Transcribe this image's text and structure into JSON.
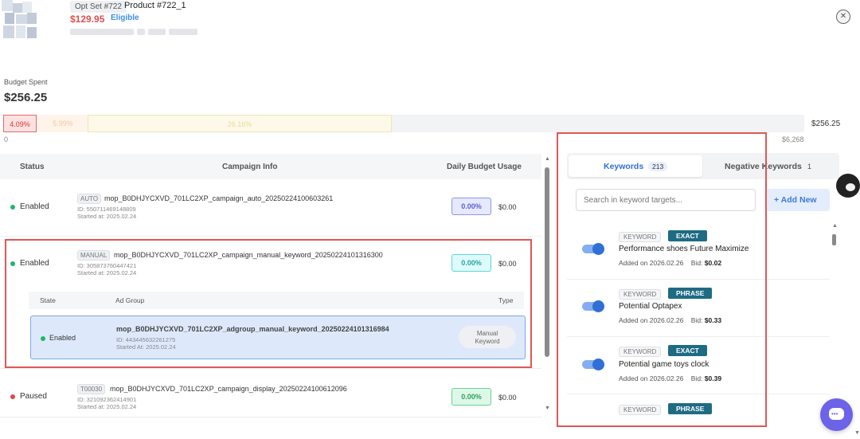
{
  "product": {
    "opt_set": "Opt Set #722",
    "title": "Product #722_1",
    "price": "$129.95",
    "eligibility": "Eligible"
  },
  "budget": {
    "label": "Budget Spent",
    "spent": "$256.25",
    "segments": [
      "4.09%",
      "5.99%",
      "26.16%"
    ],
    "bar_total": "$256.25",
    "min": "0",
    "max": "$6,268"
  },
  "table": {
    "headers": {
      "status": "Status",
      "campaign_info": "Campaign Info",
      "daily_budget": "Daily Budget Usage"
    },
    "rows": [
      {
        "status": "Enabled",
        "type": "AUTO",
        "name": "mop_B0DHJYCXVD_701LC2XP_campaign_auto_20250224100603261",
        "id": "ID: 550711469148809",
        "started": "Started at: 2025.02.24",
        "usage": "0.00%",
        "amount": "$0.00"
      },
      {
        "status": "Enabled",
        "type": "MANUAL",
        "name": "mop_B0DHJYCXVD_701LC2XP_campaign_manual_keyword_20250224101316300",
        "id": "ID: 305873760447421",
        "started": "Started at: 2025.02.24",
        "usage": "0.00%",
        "amount": "$0.00"
      },
      {
        "status": "Paused",
        "type": "T00030",
        "name": "mop_B0DHJYCXVD_701LC2XP_campaign_display_20250224100612096",
        "id": "ID: 321092362414901",
        "started": "Started at: 2025.02.24",
        "usage": "0.00%",
        "amount": "$0.00"
      }
    ],
    "adgroup": {
      "headers": {
        "state": "State",
        "ad_group": "Ad Group",
        "type": "Type"
      },
      "state": "Enabled",
      "name": "mop_B0DHJYCXVD_701LC2XP_adgroup_manual_keyword_20250224101316984",
      "id": "ID: 443445632261275",
      "started": "Started At: 2025.02.24",
      "type_line1": "Manual",
      "type_line2": "Keyword"
    }
  },
  "keywords_panel": {
    "tab_keywords": "Keywords",
    "tab_keywords_count": "213",
    "tab_negative": "Negative Keywords",
    "tab_negative_count": "1",
    "search_placeholder": "Search in keyword targets...",
    "add_new": "+ Add New",
    "items": [
      {
        "tag": "KEYWORD",
        "match": "EXACT",
        "text": "Performance shoes Future Maximize",
        "added": "Added on 2026.02.26",
        "bid_label": "Bid:",
        "bid": "$0.02"
      },
      {
        "tag": "KEYWORD",
        "match": "PHRASE",
        "text": "Potential Optapex",
        "added": "Added on 2026.02.26",
        "bid_label": "Bid:",
        "bid": "$0.33"
      },
      {
        "tag": "KEYWORD",
        "match": "EXACT",
        "text": "Potential game toys clock",
        "added": "Added on 2026.02.26",
        "bid_label": "Bid:",
        "bid": "$0.39"
      },
      {
        "tag": "KEYWORD",
        "match": "PHRASE"
      }
    ]
  },
  "colors": {
    "accent_blue": "#2f6fd6",
    "highlight_red": "#e05757",
    "match_badge": "#1e6b84",
    "enabled_green": "#23b46a",
    "paused_red": "#e04646",
    "chat_purple": "#6c63e8"
  },
  "icons": {
    "close": "close-icon",
    "plus": "plus-icon",
    "chat": "chat-icon",
    "avatar": "avatar-icon"
  }
}
